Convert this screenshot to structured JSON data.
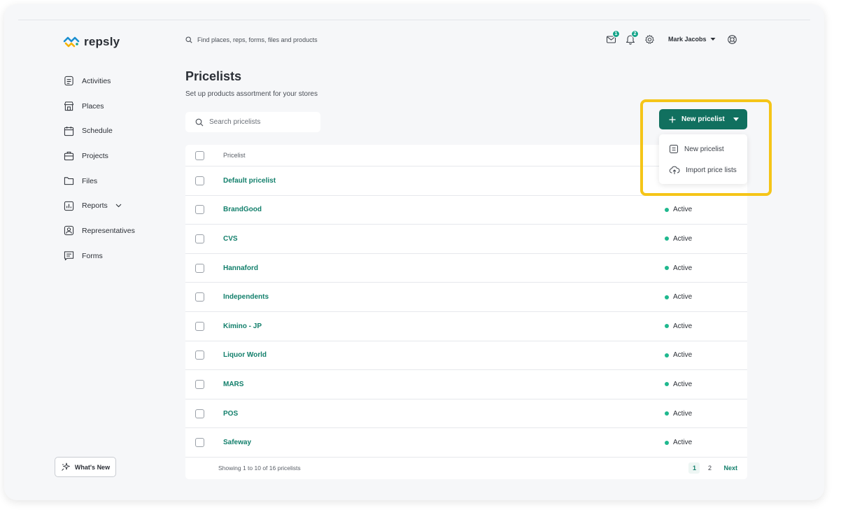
{
  "app": {
    "name": "repsly"
  },
  "colors": {
    "brand": "#11705f",
    "link": "#127f6b",
    "status_active": "#1fb88e",
    "highlight": "#f5c518"
  },
  "header": {
    "global_search_placeholder": "Find places, reps, forms, files and products",
    "messages_badge": "1",
    "notifications_badge": "2",
    "user_name": "Mark Jacobs"
  },
  "sidebar": {
    "items": [
      {
        "label": "Activities",
        "icon": "activities-icon"
      },
      {
        "label": "Places",
        "icon": "store-icon"
      },
      {
        "label": "Schedule",
        "icon": "calendar-icon"
      },
      {
        "label": "Projects",
        "icon": "briefcase-icon"
      },
      {
        "label": "Files",
        "icon": "folder-icon"
      },
      {
        "label": "Reports",
        "icon": "chart-icon"
      },
      {
        "label": "Representatives",
        "icon": "person-icon"
      },
      {
        "label": "Forms",
        "icon": "form-icon"
      }
    ],
    "whats_new": "What's New"
  },
  "main": {
    "title": "Pricelists",
    "subtitle": "Set up products assortment for your stores",
    "search_placeholder": "Search pricelists",
    "new_button": "New pricelist",
    "dropdown": [
      {
        "label": "New pricelist",
        "icon": "document-icon"
      },
      {
        "label": "Import price lists",
        "icon": "cloud-upload-icon"
      }
    ]
  },
  "table": {
    "header": "Pricelist",
    "rows": [
      {
        "name": "Default pricelist",
        "status": ""
      },
      {
        "name": "BrandGood",
        "status": "Active"
      },
      {
        "name": "CVS",
        "status": "Active"
      },
      {
        "name": "Hannaford",
        "status": "Active"
      },
      {
        "name": "Independents",
        "status": "Active"
      },
      {
        "name": "Kimino - JP",
        "status": "Active"
      },
      {
        "name": "Liquor World",
        "status": "Active"
      },
      {
        "name": "MARS",
        "status": "Active"
      },
      {
        "name": "POS",
        "status": "Active"
      },
      {
        "name": "Safeway",
        "status": "Active"
      }
    ],
    "footer": "Showing 1 to 10 of 16 pricelists",
    "pages": [
      "1",
      "2"
    ],
    "next": "Next"
  }
}
